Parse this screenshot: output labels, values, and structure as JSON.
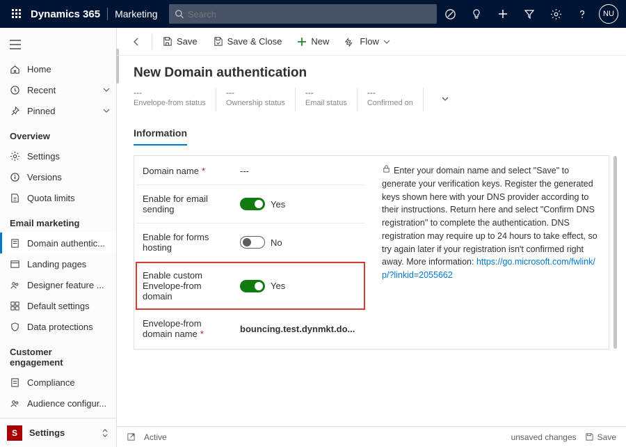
{
  "top": {
    "brand": "Dynamics 365",
    "appName": "Marketing",
    "searchPlaceholder": "Search",
    "avatar": "NU"
  },
  "sidebar": {
    "items": [
      {
        "icon": "home",
        "label": "Home"
      },
      {
        "icon": "clock",
        "label": "Recent",
        "chev": true
      },
      {
        "icon": "pin",
        "label": "Pinned",
        "chev": true
      }
    ],
    "overview": {
      "title": "Overview",
      "items": [
        {
          "icon": "gear",
          "label": "Settings"
        },
        {
          "icon": "info",
          "label": "Versions"
        },
        {
          "icon": "quota",
          "label": "Quota limits"
        }
      ]
    },
    "email": {
      "title": "Email marketing",
      "items": [
        {
          "icon": "doc",
          "label": "Domain authentic...",
          "selected": true
        },
        {
          "icon": "page",
          "label": "Landing pages"
        },
        {
          "icon": "people",
          "label": "Designer feature ..."
        },
        {
          "icon": "grid",
          "label": "Default settings"
        },
        {
          "icon": "shield",
          "label": "Data protections"
        }
      ]
    },
    "engagement": {
      "title": "Customer engagement",
      "items": [
        {
          "icon": "doc2",
          "label": "Compliance"
        },
        {
          "icon": "people",
          "label": "Audience configur..."
        }
      ]
    },
    "area": {
      "badge": "S",
      "label": "Settings"
    }
  },
  "cmd": {
    "save": "Save",
    "saveClose": "Save & Close",
    "new": "New",
    "flow": "Flow"
  },
  "page": {
    "title": "New Domain authentication",
    "status": [
      {
        "value": "---",
        "label": "Envelope-from status"
      },
      {
        "value": "---",
        "label": "Ownership status"
      },
      {
        "value": "---",
        "label": "Email status"
      },
      {
        "value": "---",
        "label": "Confirmed on"
      }
    ],
    "tab": "Information"
  },
  "form": {
    "domainName": {
      "label": "Domain name",
      "value": "---",
      "required": true
    },
    "emailSending": {
      "label": "Enable for email sending",
      "value": "Yes",
      "on": true
    },
    "formsHosting": {
      "label": "Enable for forms hosting",
      "value": "No",
      "on": false
    },
    "customEnvelope": {
      "label": "Enable custom Envelope-from domain",
      "value": "Yes",
      "on": true
    },
    "envDomain": {
      "label": "Envelope-from domain name",
      "value": "bouncing.test.dynmkt.do...",
      "required": true
    }
  },
  "info": {
    "text": "Enter your domain name and select \"Save\" to generate your verification keys. Register the generated keys shown here with your DNS provider according to their instructions. Return here and select \"Confirm DNS registration\" to complete the authentication. DNS registration may require up to 24 hours to take effect, so try again later if your registration isn't confirmed right away. More information: ",
    "link": "https://go.microsoft.com/fwlink/p/?linkid=2055662"
  },
  "footer": {
    "status": "Active",
    "unsaved": "unsaved changes",
    "save": "Save"
  }
}
